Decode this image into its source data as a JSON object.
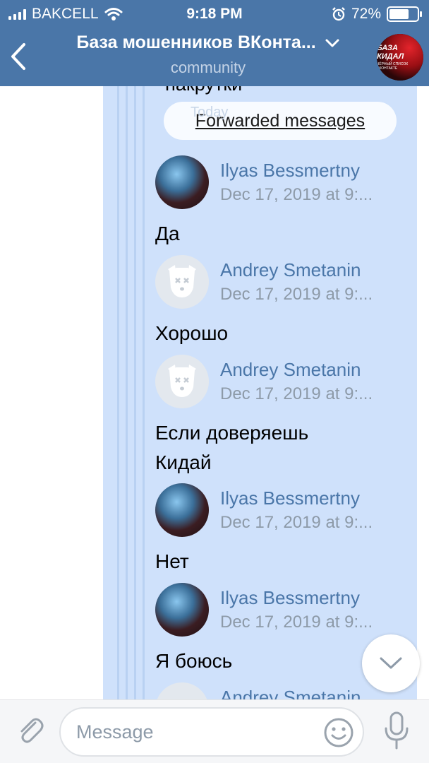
{
  "status_bar": {
    "carrier": "BAKCELL",
    "time": "9:18 PM",
    "battery_percent": "72%",
    "battery_level": 0.72
  },
  "header": {
    "title": "База мошенников ВКонта...",
    "subtitle": "community"
  },
  "group_avatar": {
    "line1": "БАЗА КИДАЛ",
    "line2": "ЧЁРНЫЙ СПИСОК ВКОНТАКТЕ"
  },
  "chat": {
    "partial_text": "накрутки",
    "date_pill": "Today",
    "pill_label": "Forwarded messages",
    "messages": [
      {
        "author": "Ilyas Bessmertny",
        "date": "Dec 17, 2019 at 9:...",
        "text": "Да",
        "avatar": "ilyas"
      },
      {
        "author": "Andrey Smetanin",
        "date": "Dec 17, 2019 at 9:...",
        "text": "Хорошо",
        "avatar": "andrey"
      },
      {
        "author": "Andrey Smetanin",
        "date": "Dec 17, 2019 at 9:...",
        "text_lines": [
          "Если доверяешь",
          "Кидай"
        ],
        "avatar": "andrey"
      },
      {
        "author": "Ilyas Bessmertny",
        "date": "Dec 17, 2019 at 9:...",
        "text": "Нет",
        "avatar": "ilyas"
      },
      {
        "author": "Ilyas Bessmertny",
        "date": "Dec 17, 2019 at 9:...",
        "text": "Я боюсь",
        "avatar": "ilyas"
      },
      {
        "author": "Andrey Smetanin",
        "avatar": "andrey"
      }
    ]
  },
  "input": {
    "placeholder": "Message"
  },
  "colors": {
    "header_bg": "#4a76a8",
    "bubble_bg": "#cfe1fb",
    "name_color": "#4a76a8",
    "date_color": "#8d9aa8"
  },
  "icons": [
    "signal-icon",
    "wifi-icon",
    "alarm-icon",
    "battery-icon",
    "back-icon",
    "chevron-down-icon",
    "scroll-down-icon",
    "attach-icon",
    "emoji-icon",
    "mic-icon"
  ]
}
